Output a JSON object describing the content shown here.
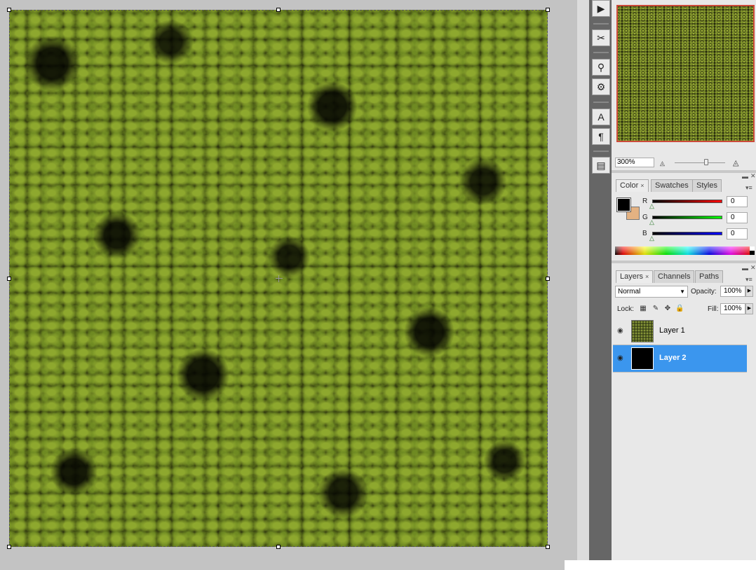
{
  "canvas": {
    "description_icon": "canvas-image"
  },
  "toolbar": {
    "buttons": [
      {
        "name": "play-icon",
        "glyph": "▶"
      },
      {
        "name": "brush-tools-icon",
        "glyph": "✂"
      },
      {
        "name": "clone-source-icon",
        "glyph": "⚲"
      },
      {
        "name": "tool-presets-icon",
        "glyph": "⚙"
      },
      {
        "name": "character-icon",
        "glyph": "A"
      },
      {
        "name": "paragraph-icon",
        "glyph": "¶"
      },
      {
        "name": "notes-icon",
        "glyph": "▤"
      }
    ]
  },
  "navigator": {
    "zoom": "300%",
    "zoom_slider_level": 0.62
  },
  "color_panel": {
    "tabs": [
      "Color",
      "Swatches",
      "Styles"
    ],
    "close_glyph": "×",
    "foreground": "#000000",
    "background": "#e4b282",
    "channels": [
      {
        "label": "R",
        "value": "0",
        "gradient_end": "#ff0000"
      },
      {
        "label": "G",
        "value": "0",
        "gradient_end": "#00ff00"
      },
      {
        "label": "B",
        "value": "0",
        "gradient_end": "#0000ff"
      }
    ]
  },
  "layers_panel": {
    "tabs": [
      "Layers",
      "Channels",
      "Paths"
    ],
    "close_glyph": "×",
    "blend_mode": "Normal",
    "opacity_label": "Opacity:",
    "opacity_value": "100%",
    "lock_label": "Lock:",
    "fill_label": "Fill:",
    "fill_value": "100%",
    "layers": [
      {
        "name": "Layer 1",
        "selected": false
      },
      {
        "name": "Layer 2",
        "selected": true
      }
    ],
    "selection_color": "#3b96ee"
  }
}
